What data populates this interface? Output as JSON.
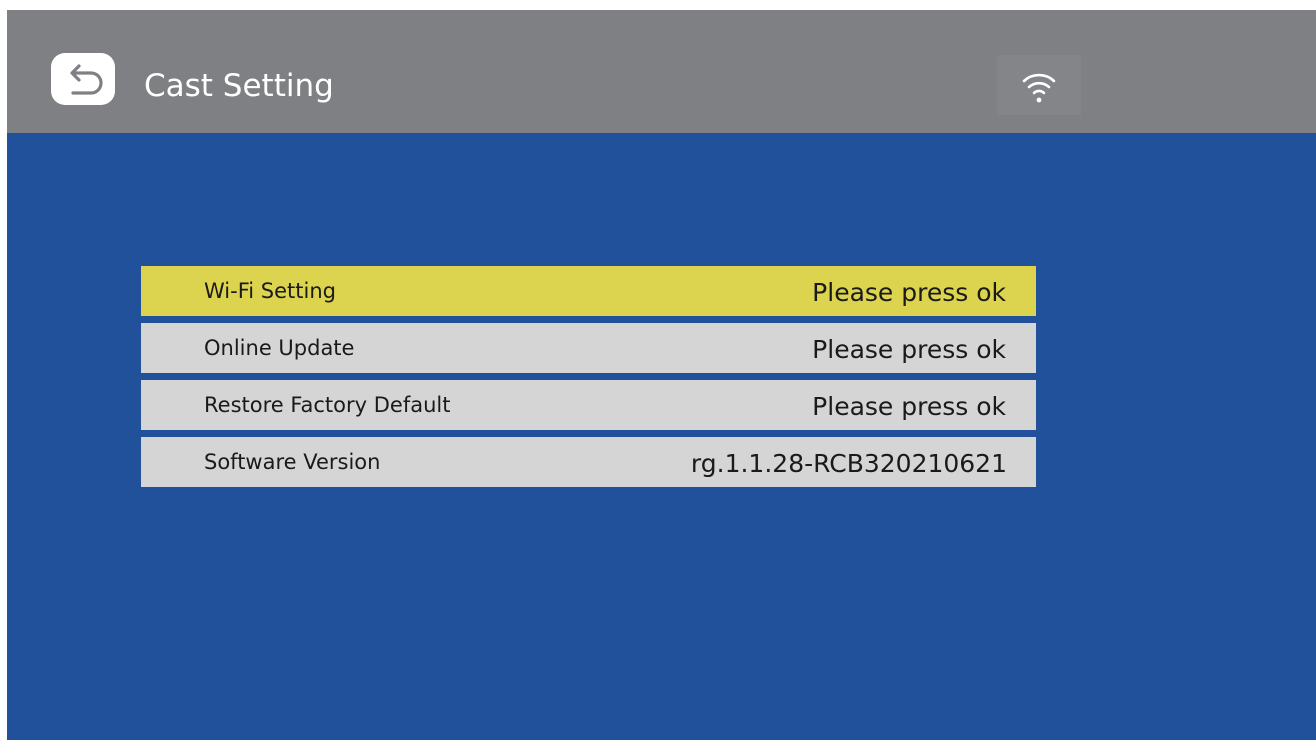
{
  "header": {
    "title": "Cast Setting",
    "back_icon": "back-arrow-icon",
    "status_icon": "wifi-icon"
  },
  "menu": {
    "items": [
      {
        "label": "Wi-Fi Setting",
        "value": "Please press ok",
        "selected": true
      },
      {
        "label": "Online Update",
        "value": "Please press ok",
        "selected": false
      },
      {
        "label": "Restore Factory Default",
        "value": "Please press ok",
        "selected": false
      },
      {
        "label": "Software Version",
        "value": "rg.1.1.28-RCB320210621",
        "selected": false
      }
    ]
  },
  "colors": {
    "background": "#21519a",
    "header": "#7e8083",
    "row": "#d5d5d6",
    "row_selected": "#dcd34f",
    "text": "#1a1a1a"
  }
}
